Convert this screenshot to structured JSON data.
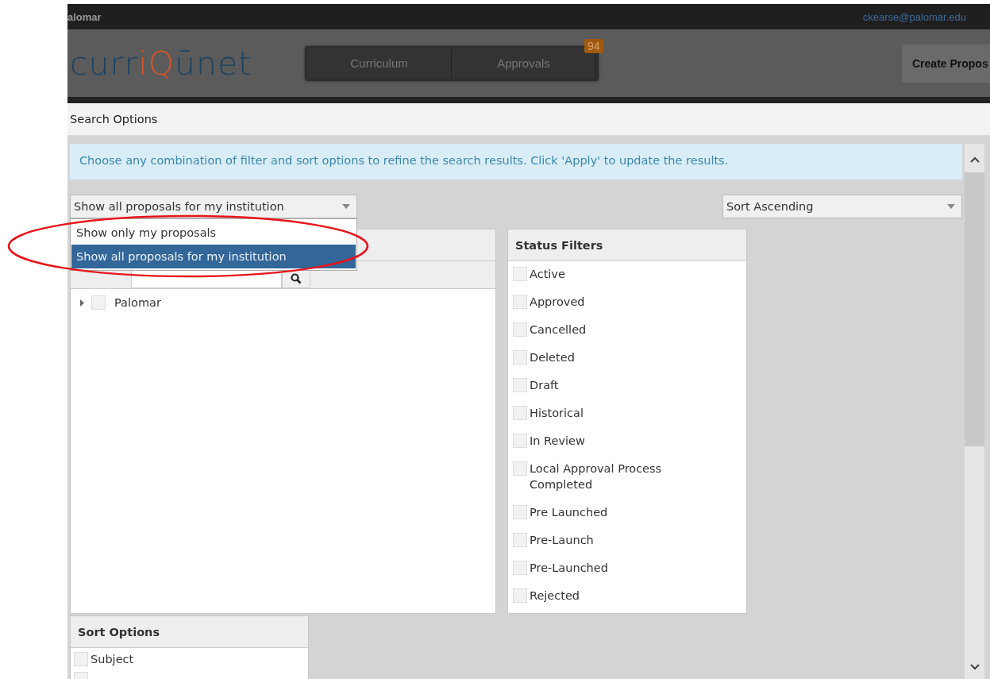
{
  "top_bar": {
    "institution": "alomar",
    "user_email": "ckearse@palomar.edu"
  },
  "header": {
    "logo": [
      {
        "text": "curr",
        "accent": false
      },
      {
        "text": "iQ",
        "accent": true
      },
      {
        "text": "ūnet",
        "accent": false
      }
    ],
    "nav_tabs": [
      {
        "label": "Curriculum",
        "selected": false
      },
      {
        "label": "Approvals",
        "selected": false,
        "badge": "94"
      }
    ],
    "create_button": "Create Propos"
  },
  "section_title": "Search Options",
  "notice": "Choose any combination of filter and sort options to refine the search results. Click 'Apply' to update the results.",
  "scope_select": {
    "value": "Show all proposals for my institution",
    "expanded": true,
    "options": [
      {
        "label": "Show only my proposals",
        "selected": false
      },
      {
        "label": "Show all proposals for my institution",
        "selected": true
      }
    ]
  },
  "sort_select": {
    "value": "Sort Ascending"
  },
  "tree_panel": {
    "items": [
      {
        "label": "Palomar",
        "checked": false,
        "expanded": false
      }
    ]
  },
  "status_filters": {
    "title": "Status Filters",
    "items": [
      {
        "label": "Active",
        "checked": false
      },
      {
        "label": "Approved",
        "checked": false
      },
      {
        "label": "Cancelled",
        "checked": false
      },
      {
        "label": "Deleted",
        "checked": false
      },
      {
        "label": "Draft",
        "checked": false
      },
      {
        "label": "Historical",
        "checked": false
      },
      {
        "label": "In Review",
        "checked": false
      },
      {
        "label": "Local Approval Process Completed",
        "checked": false
      },
      {
        "label": "Pre Launched",
        "checked": false
      },
      {
        "label": "Pre-Launch",
        "checked": false
      },
      {
        "label": "Pre-Launched",
        "checked": false
      },
      {
        "label": "Rejected",
        "checked": false
      }
    ]
  },
  "sort_options": {
    "title": "Sort Options",
    "items": [
      {
        "label": "Subject",
        "checked": false
      },
      {
        "checked": false
      }
    ]
  },
  "annotation": {
    "kind": "ellipse"
  }
}
